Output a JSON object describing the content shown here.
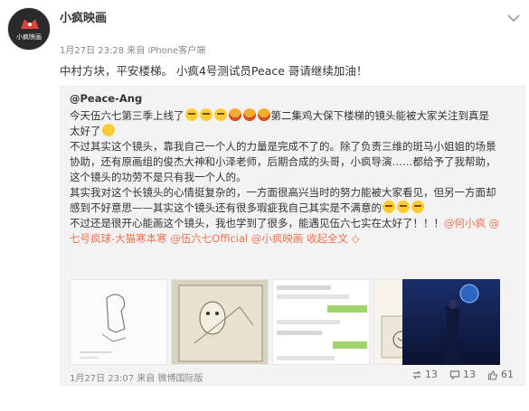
{
  "post": {
    "username": "小疯映画",
    "avatar_label": "小疯映画",
    "time": "1月27日 23:28",
    "source": "来自 iPhone客户端",
    "text": "中村方块，平安楼梯。 小疯4号测试员Peace 哥请继续加油！"
  },
  "repost": {
    "author": "@Peace-Ang",
    "lines": [
      {
        "parts": [
          {
            "t": "今天伍六七第三季上线了",
            "link": false
          },
          {
            "emoji": "cry"
          },
          {
            "emoji": "cry"
          },
          {
            "emoji": "cry"
          },
          {
            "emoji": "red"
          },
          {
            "emoji": "red"
          },
          {
            "emoji": "red"
          },
          {
            "t": "第二集鸡大保下楼梯的镜头能被大家关注到真是",
            "link": false
          }
        ]
      },
      {
        "parts": [
          {
            "t": "太好了",
            "link": false
          },
          {
            "emoji": "smile"
          }
        ]
      },
      {
        "parts": [
          {
            "t": "不过其实这个镜头，靠我自己一个人的力量是完成不了的。除了负责三维的斑马小姐姐的场景",
            "link": false
          }
        ]
      },
      {
        "parts": [
          {
            "t": "协助，还有原画组的俊杰大神和小泽老师，后期合成的头哥，小疯导演……都给予了我帮助，",
            "link": false
          }
        ]
      },
      {
        "parts": [
          {
            "t": "这个镜头的功劳不是只有我一个人的。",
            "link": false
          }
        ]
      },
      {
        "parts": [
          {
            "t": "其实我对这个长镜头的心情挺复杂的，一方面很高兴当时的努力能被大家看见，但另一方面却",
            "link": false
          }
        ]
      },
      {
        "parts": [
          {
            "t": "感到不好意思——其实这个镜头还有很多瑕疵我自己其实是不满意的",
            "link": false
          },
          {
            "emoji": "cry"
          },
          {
            "emoji": "cry"
          },
          {
            "emoji": "cry"
          }
        ]
      },
      {
        "parts": [
          {
            "t": "不过还是很开心能画这个镜头，我也学到了很多，能遇见伍六七实在太好了！！！",
            "link": false
          },
          {
            "t": "@何小疯 @",
            "link": true
          }
        ]
      },
      {
        "parts": [
          {
            "t": "七号疯球-大猫寒本寒",
            "link": true
          },
          {
            "t": " ",
            "link": false
          },
          {
            "t": "@伍六七Official",
            "link": true
          },
          {
            "t": " ",
            "link": false
          },
          {
            "t": "@小疯映画",
            "link": true
          },
          {
            "t": " ",
            "link": false
          },
          {
            "t": "收起全文",
            "link": true
          },
          {
            "t": " ◇",
            "link": true
          }
        ]
      }
    ],
    "thumbnails": [
      {
        "name": "sketch-frame-1"
      },
      {
        "name": "sketch-frame-2"
      },
      {
        "name": "chat-screenshot"
      },
      {
        "name": "sketch-frame-3"
      },
      {
        "name": "poster-image"
      }
    ],
    "time": "1月27日 23:07",
    "source": "来自 微博国际版",
    "reposts": "13",
    "comments": "13",
    "likes": "61"
  },
  "colors": {
    "link": "#eb7350",
    "repost_bg": "#f3f3f3"
  },
  "icons": {
    "dropdown": "chevron-down-icon",
    "repost": "repost-icon",
    "comment": "comment-icon",
    "like": "thumbs-up-icon"
  }
}
